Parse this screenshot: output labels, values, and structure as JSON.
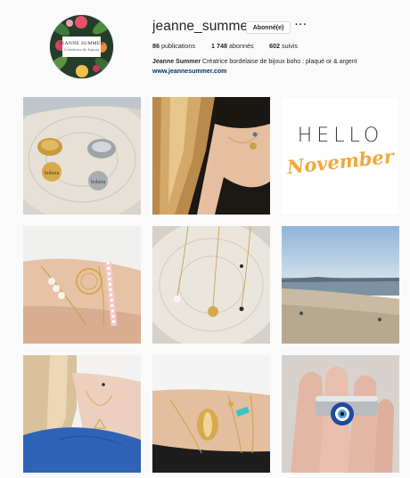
{
  "profile": {
    "username": "jeanne_summer",
    "follow_label": "Abonné(e)",
    "more_label": "···",
    "avatar": {
      "brand_line1": "JEANNE SUMMER",
      "brand_line2": "Créations de bijoux"
    }
  },
  "stats": {
    "posts_count": "86",
    "posts_label": "publications",
    "followers_count": "1 748",
    "followers_label": "abonnés",
    "following_count": "602",
    "following_label": "suivis"
  },
  "bio": {
    "name": "Jeanne Summer",
    "text": "Créatrice bordelaise de bijoux boho : plaqué or & argent",
    "website": "www.jeannesummer.com"
  },
  "grid": {
    "posts": [
      {
        "subject": "gold and silver open rings with engraved tags on a wooden slice",
        "tag_text": "bohera"
      },
      {
        "subject": "woman with blonde hair wearing a gold pendant necklace"
      },
      {
        "subject": "hello november lettering",
        "line1": "HELLO",
        "line2": "November"
      },
      {
        "subject": "wrist stacked with beaded and gold bracelets"
      },
      {
        "subject": "gold pendant necklaces laid on a wooden slice"
      },
      {
        "subject": "sandy beach with the sea under a blue sky"
      },
      {
        "subject": "woman in a blue sweater with a triangle necklace"
      },
      {
        "subject": "wrist with cowrie shell and turquoise bracelets"
      },
      {
        "subject": "hand wearing a silver ring with a blue evil eye"
      }
    ]
  },
  "colors": {
    "link": "#003569",
    "text": "#262626",
    "border": "#dbdbdb",
    "lettering": "#f0a93a"
  }
}
